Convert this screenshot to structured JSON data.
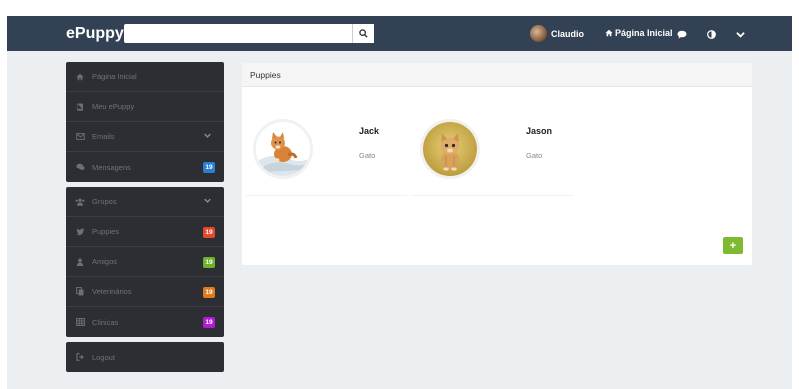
{
  "header": {
    "brand": "ePuppy",
    "search": {
      "placeholder": ""
    },
    "user_name": "Claudio",
    "home_label": "Página Inicial"
  },
  "sidebar": {
    "groups": [
      {
        "items": [
          {
            "label": "Página Inicial",
            "icon": "home-icon"
          },
          {
            "label": "Meu ePuppy",
            "icon": "book-icon"
          },
          {
            "label": "Emails",
            "icon": "envelope-icon",
            "has_chevron": true
          },
          {
            "label": "Mensagens",
            "icon": "chat-icon",
            "badge": "19",
            "badge_color": "#2a7fd4"
          }
        ]
      },
      {
        "items": [
          {
            "label": "Grupos",
            "icon": "group-icon",
            "has_chevron": true
          },
          {
            "label": "Puppies",
            "icon": "bird-icon",
            "badge": "19",
            "badge_color": "#e24a2b"
          },
          {
            "label": "Amigos",
            "icon": "user-icon",
            "badge": "19",
            "badge_color": "#6fb02e"
          },
          {
            "label": "Veterinários",
            "icon": "copy-icon",
            "badge": "19",
            "badge_color": "#e07b1d"
          },
          {
            "label": "Clinicas",
            "icon": "table-icon",
            "badge": "19",
            "badge_color": "#b21bd3"
          }
        ]
      },
      {
        "items": [
          {
            "label": "Logout",
            "icon": "logout-icon"
          }
        ]
      }
    ]
  },
  "panel": {
    "title": "Puppies",
    "pets": [
      {
        "name": "Jack",
        "species": "Gato"
      },
      {
        "name": "Jason",
        "species": "Gato"
      }
    ],
    "add_label": "+"
  },
  "colors": {
    "topbar": "#334154",
    "sidebar": "#2d2e33",
    "accent_green": "#7dba2f"
  }
}
